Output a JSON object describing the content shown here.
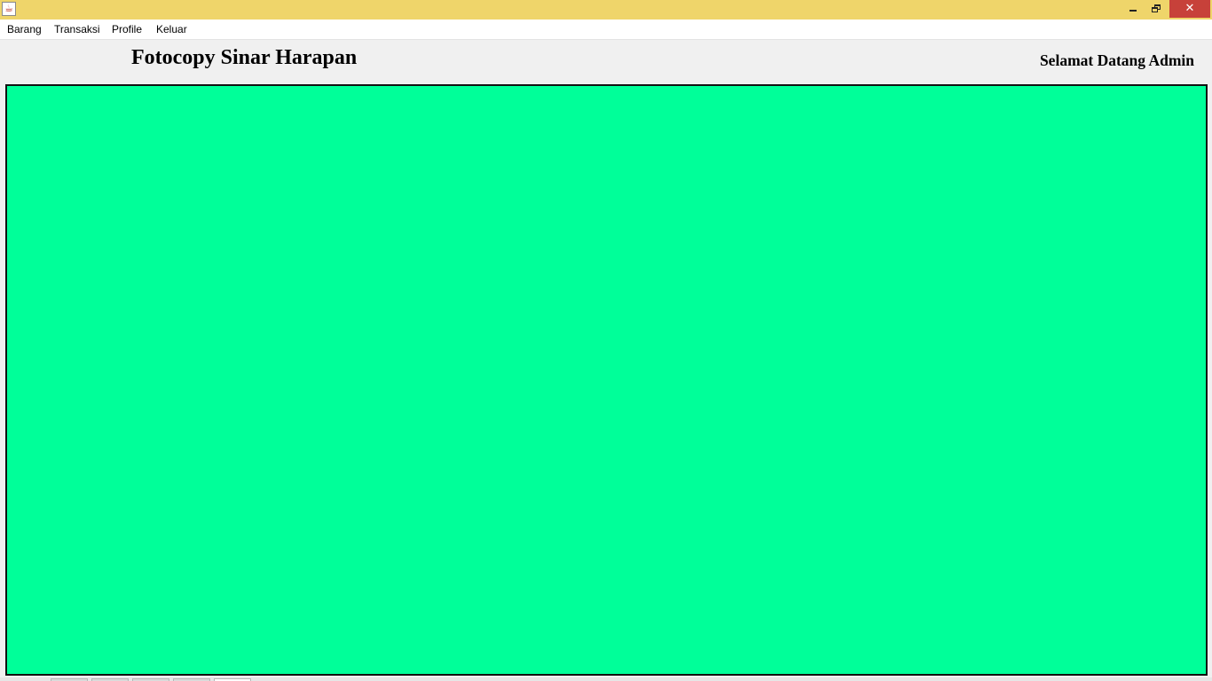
{
  "window": {
    "icon": "java-coffee-icon",
    "controls": {
      "minimize_icon": "minimize-icon",
      "maximize_icon": "restore-icon",
      "close_glyph": "✕"
    },
    "titlebar_color": "#efd56a",
    "close_color": "#c7413a"
  },
  "menubar": {
    "items": [
      {
        "label": "Barang"
      },
      {
        "label": "Transaksi"
      },
      {
        "label": "Profile"
      },
      {
        "label": "Keluar"
      }
    ]
  },
  "header": {
    "title": "Fotocopy Sinar Harapan",
    "welcome": "Selamat Datang Admin"
  },
  "content": {
    "background_color": "#00ff99"
  }
}
